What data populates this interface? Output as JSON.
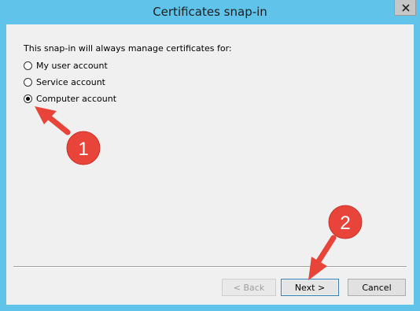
{
  "window": {
    "title": "Certificates snap-in",
    "close_icon": "close-icon"
  },
  "content": {
    "prompt": "This snap-in will always manage certificates for:",
    "options": [
      {
        "label": "My user account",
        "checked": false
      },
      {
        "label": "Service account",
        "checked": false
      },
      {
        "label": "Computer account",
        "checked": true
      }
    ]
  },
  "buttons": {
    "back": "< Back",
    "next": "Next >",
    "cancel": "Cancel"
  },
  "annotations": {
    "step1": "1",
    "step2": "2",
    "color": "#e8443a"
  }
}
